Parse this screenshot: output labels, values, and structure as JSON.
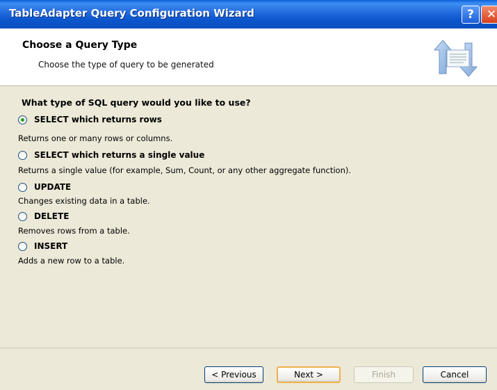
{
  "window": {
    "title": "TableAdapter Query Configuration Wizard",
    "help_glyph": "?",
    "close_glyph": "✕"
  },
  "header": {
    "title": "Choose a Query Type",
    "subtitle": "Choose the type of query to be generated",
    "graphic_icon": "database-sync-icon"
  },
  "main": {
    "question": "What type of SQL query would you like to use?",
    "options": [
      {
        "label": "SELECT which returns rows",
        "description": "Returns one or many rows or columns.",
        "checked": true
      },
      {
        "label": "SELECT which returns a single value",
        "description": "Returns a single value (for example, Sum, Count, or any other aggregate function).",
        "checked": false
      },
      {
        "label": "UPDATE",
        "description": "Changes existing data in a table.",
        "checked": false
      },
      {
        "label": "DELETE",
        "description": "Removes rows from a table.",
        "checked": false
      },
      {
        "label": "INSERT",
        "description": "Adds a new row to a table.",
        "checked": false
      }
    ]
  },
  "footer": {
    "previous_label": "< Previous",
    "next_label": "Next >",
    "finish_label": "Finish",
    "cancel_label": "Cancel",
    "finish_enabled": false
  },
  "colors": {
    "titlebar": "#0a5fd8",
    "dialog_bg": "#ece9d8",
    "radio_dot": "#21a121",
    "default_button_border": "#f0b14a"
  }
}
